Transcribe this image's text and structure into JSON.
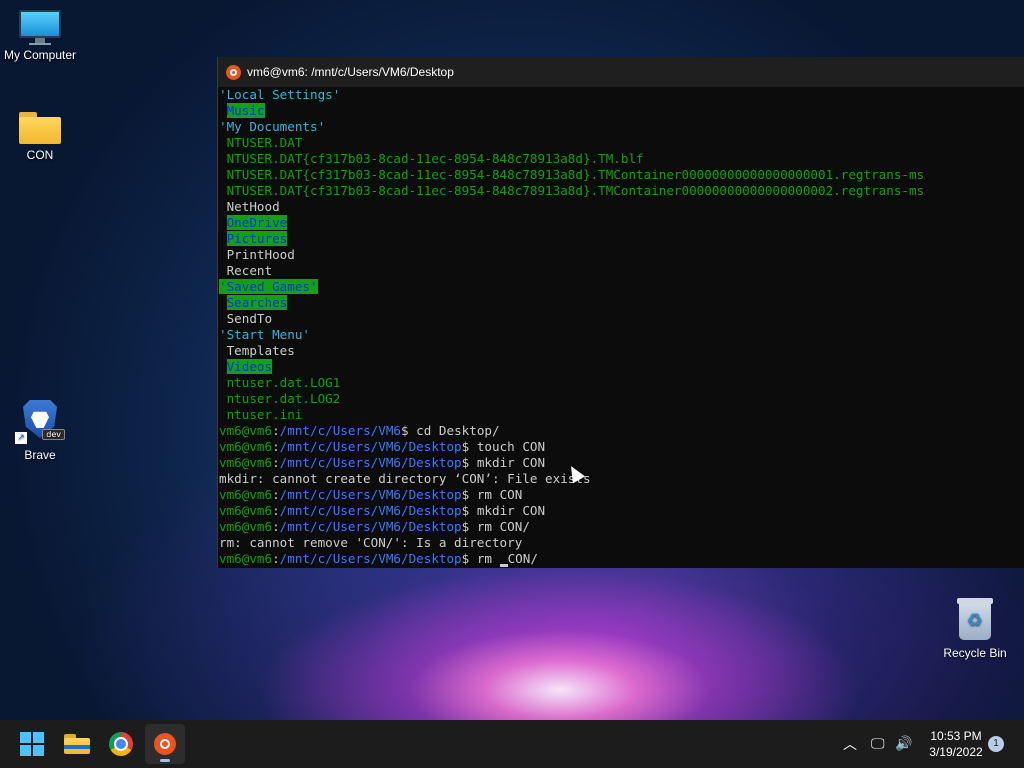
{
  "desktop": {
    "icons": [
      {
        "label": "My Computer"
      },
      {
        "label": "CON"
      },
      {
        "label": "Brave",
        "badge": "dev"
      },
      {
        "label": "Recycle Bin"
      }
    ]
  },
  "terminal": {
    "title": "vm6@vm6: /mnt/c/Users/VM6/Desktop",
    "lines": [
      {
        "text": "'Local Settings'",
        "style": "cyan"
      },
      {
        "text": "Music",
        "style": "hl",
        "indent": true
      },
      {
        "text": "'My Documents'",
        "style": "cyan"
      },
      {
        "text": "NTUSER.DAT",
        "style": "green",
        "indent": true
      },
      {
        "text": "NTUSER.DAT{cf317b03-8cad-11ec-8954-848c78913a8d}.TM.blf",
        "style": "green",
        "indent": true
      },
      {
        "text": "NTUSER.DAT{cf317b03-8cad-11ec-8954-848c78913a8d}.TMContainer00000000000000000001.regtrans-ms",
        "style": "green",
        "indent": true
      },
      {
        "text": "NTUSER.DAT{cf317b03-8cad-11ec-8954-848c78913a8d}.TMContainer00000000000000000002.regtrans-ms",
        "style": "green",
        "indent": true
      },
      {
        "text": "NetHood",
        "style": "white",
        "indent": true
      },
      {
        "text": "OneDrive",
        "style": "hl",
        "indent": true
      },
      {
        "text": "Pictures",
        "style": "hl",
        "indent": true
      },
      {
        "text": "PrintHood",
        "style": "white",
        "indent": true
      },
      {
        "text": "Recent",
        "style": "white",
        "indent": true
      },
      {
        "text": "'Saved Games'",
        "style": "hl"
      },
      {
        "text": "Searches",
        "style": "hl",
        "indent": true
      },
      {
        "text": "SendTo",
        "style": "white",
        "indent": true
      },
      {
        "text": "'Start Menu'",
        "style": "cyan"
      },
      {
        "text": "Templates",
        "style": "white",
        "indent": true
      },
      {
        "text": "Videos",
        "style": "hl",
        "indent": true
      },
      {
        "text": "ntuser.dat.LOG1",
        "style": "green",
        "indent": true
      },
      {
        "text": "ntuser.dat.LOG2",
        "style": "green",
        "indent": true
      },
      {
        "text": "ntuser.ini",
        "style": "green",
        "indent": true
      }
    ],
    "prompt_user": "vm6@vm6",
    "commands": [
      {
        "path": "/mnt/c/Users/VM6",
        "cmd": " cd Desktop/"
      },
      {
        "path": "/mnt/c/Users/VM6/Desktop",
        "cmd": " touch CON"
      },
      {
        "path": "/mnt/c/Users/VM6/Desktop",
        "cmd": " mkdir CON"
      },
      {
        "output": "mkdir: cannot create directory ‘CON’: File exists"
      },
      {
        "path": "/mnt/c/Users/VM6/Desktop",
        "cmd": " rm CON"
      },
      {
        "path": "/mnt/c/Users/VM6/Desktop",
        "cmd": " mkdir CON"
      },
      {
        "path": "/mnt/c/Users/VM6/Desktop",
        "cmd": " rm CON/"
      },
      {
        "output": "rm: cannot remove 'CON/': Is a directory"
      },
      {
        "path": "/mnt/c/Users/VM6/Desktop",
        "cmd": " rm CON/",
        "cursor": true
      }
    ]
  },
  "taskbar": {
    "time": "10:53 PM",
    "date": "3/19/2022",
    "notification_count": "1",
    "apps": [
      "start-icon",
      "file-explorer-icon",
      "chrome-icon",
      "ubuntu-icon"
    ]
  },
  "colors": {
    "terminal_bg": "#0c0c0c",
    "green": "#13a10e",
    "blue": "#3b78ff",
    "cyan": "#3bb3d9"
  }
}
